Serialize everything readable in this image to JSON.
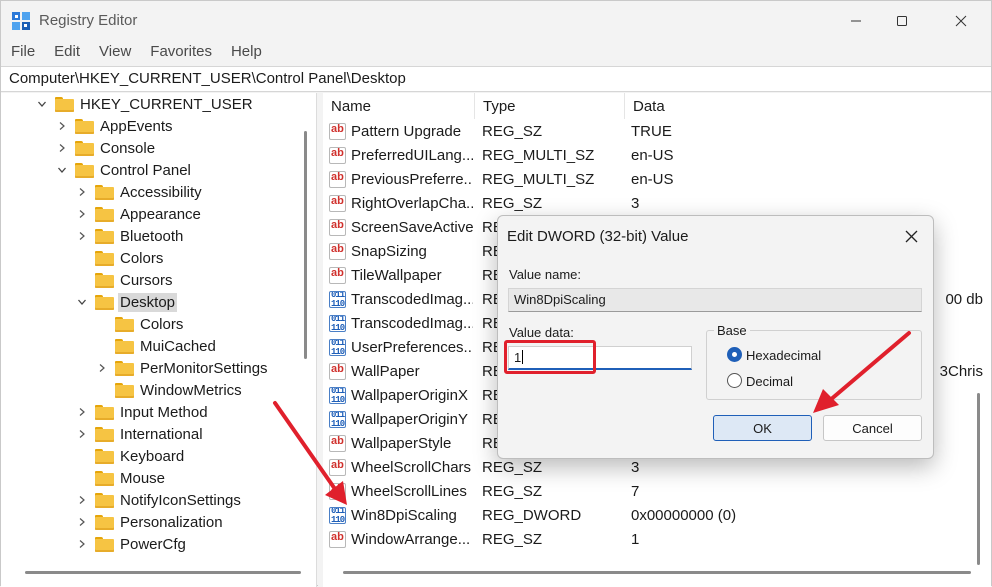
{
  "window": {
    "title": "Registry Editor",
    "icon": "registry-icon",
    "controls": [
      "minimize-icon",
      "maximize-icon",
      "close-icon"
    ]
  },
  "menu": [
    "File",
    "Edit",
    "View",
    "Favorites",
    "Help"
  ],
  "address": "Computer\\HKEY_CURRENT_USER\\Control Panel\\Desktop",
  "tree": [
    {
      "label": "HKEY_CURRENT_USER",
      "depth": 0,
      "state": "expanded"
    },
    {
      "label": "AppEvents",
      "depth": 1,
      "state": "collapsed"
    },
    {
      "label": "Console",
      "depth": 1,
      "state": "collapsed"
    },
    {
      "label": "Control Panel",
      "depth": 1,
      "state": "expanded"
    },
    {
      "label": "Accessibility",
      "depth": 2,
      "state": "collapsed"
    },
    {
      "label": "Appearance",
      "depth": 2,
      "state": "collapsed"
    },
    {
      "label": "Bluetooth",
      "depth": 2,
      "state": "collapsed"
    },
    {
      "label": "Colors",
      "depth": 2,
      "state": "none"
    },
    {
      "label": "Cursors",
      "depth": 2,
      "state": "none"
    },
    {
      "label": "Desktop",
      "depth": 2,
      "state": "expanded",
      "selected": true
    },
    {
      "label": "Colors",
      "depth": 3,
      "state": "none"
    },
    {
      "label": "MuiCached",
      "depth": 3,
      "state": "none"
    },
    {
      "label": "PerMonitorSettings",
      "depth": 3,
      "state": "collapsed"
    },
    {
      "label": "WindowMetrics",
      "depth": 3,
      "state": "none"
    },
    {
      "label": "Input Method",
      "depth": 2,
      "state": "collapsed"
    },
    {
      "label": "International",
      "depth": 2,
      "state": "collapsed"
    },
    {
      "label": "Keyboard",
      "depth": 2,
      "state": "none"
    },
    {
      "label": "Mouse",
      "depth": 2,
      "state": "none"
    },
    {
      "label": "NotifyIconSettings",
      "depth": 2,
      "state": "collapsed"
    },
    {
      "label": "Personalization",
      "depth": 2,
      "state": "collapsed"
    },
    {
      "label": "PowerCfg",
      "depth": 2,
      "state": "collapsed"
    }
  ],
  "list": {
    "columns": [
      "Name",
      "Type",
      "Data"
    ],
    "rows": [
      {
        "icon": "string-value-icon",
        "name": "Pattern Upgrade",
        "type": "REG_SZ",
        "data": "TRUE"
      },
      {
        "icon": "string-value-icon",
        "name": "PreferredUILang...",
        "type": "REG_MULTI_SZ",
        "data": "en-US"
      },
      {
        "icon": "string-value-icon",
        "name": "PreviousPreferre...",
        "type": "REG_MULTI_SZ",
        "data": "en-US"
      },
      {
        "icon": "string-value-icon",
        "name": "RightOverlapCha...",
        "type": "REG_SZ",
        "data": "3"
      },
      {
        "icon": "string-value-icon",
        "name": "ScreenSaveActive",
        "type": "RE",
        "data": ""
      },
      {
        "icon": "string-value-icon",
        "name": "SnapSizing",
        "type": "RE",
        "data": ""
      },
      {
        "icon": "string-value-icon",
        "name": "TileWallpaper",
        "type": "RE",
        "data": ""
      },
      {
        "icon": "binary-value-icon",
        "name": "TranscodedImag...",
        "type": "RE",
        "data": "00 db"
      },
      {
        "icon": "binary-value-icon",
        "name": "TranscodedImag...",
        "type": "RE",
        "data": ""
      },
      {
        "icon": "binary-value-icon",
        "name": "UserPreferences...",
        "type": "RE",
        "data": ""
      },
      {
        "icon": "string-value-icon",
        "name": "WallPaper",
        "type": "RE",
        "data": "3Chris"
      },
      {
        "icon": "binary-value-icon",
        "name": "WallpaperOriginX",
        "type": "RE",
        "data": ""
      },
      {
        "icon": "binary-value-icon",
        "name": "WallpaperOriginY",
        "type": "RE",
        "data": ""
      },
      {
        "icon": "string-value-icon",
        "name": "WallpaperStyle",
        "type": "RE",
        "data": ""
      },
      {
        "icon": "string-value-icon",
        "name": "WheelScrollChars",
        "type": "REG_SZ",
        "data": "3"
      },
      {
        "icon": "string-value-icon",
        "name": "WheelScrollLines",
        "type": "REG_SZ",
        "data": "7"
      },
      {
        "icon": "binary-value-icon",
        "name": "Win8DpiScaling",
        "type": "REG_DWORD",
        "data": "0x00000000 (0)"
      },
      {
        "icon": "string-value-icon",
        "name": "WindowArrange...",
        "type": "REG_SZ",
        "data": "1"
      }
    ]
  },
  "dialog": {
    "title": "Edit DWORD (32-bit) Value",
    "value_name_label": "Value name:",
    "value_name": "Win8DpiScaling",
    "value_data_label": "Value data:",
    "value_data": "1",
    "base_label": "Base",
    "hex_label": "Hexadecimal",
    "decimal_label": "Decimal",
    "base_selected": "Hexadecimal",
    "ok_label": "OK",
    "cancel_label": "Cancel"
  },
  "colors": {
    "accent": "#1f5fb8",
    "annotation": "#e0202c",
    "folder": "#f6c443"
  }
}
